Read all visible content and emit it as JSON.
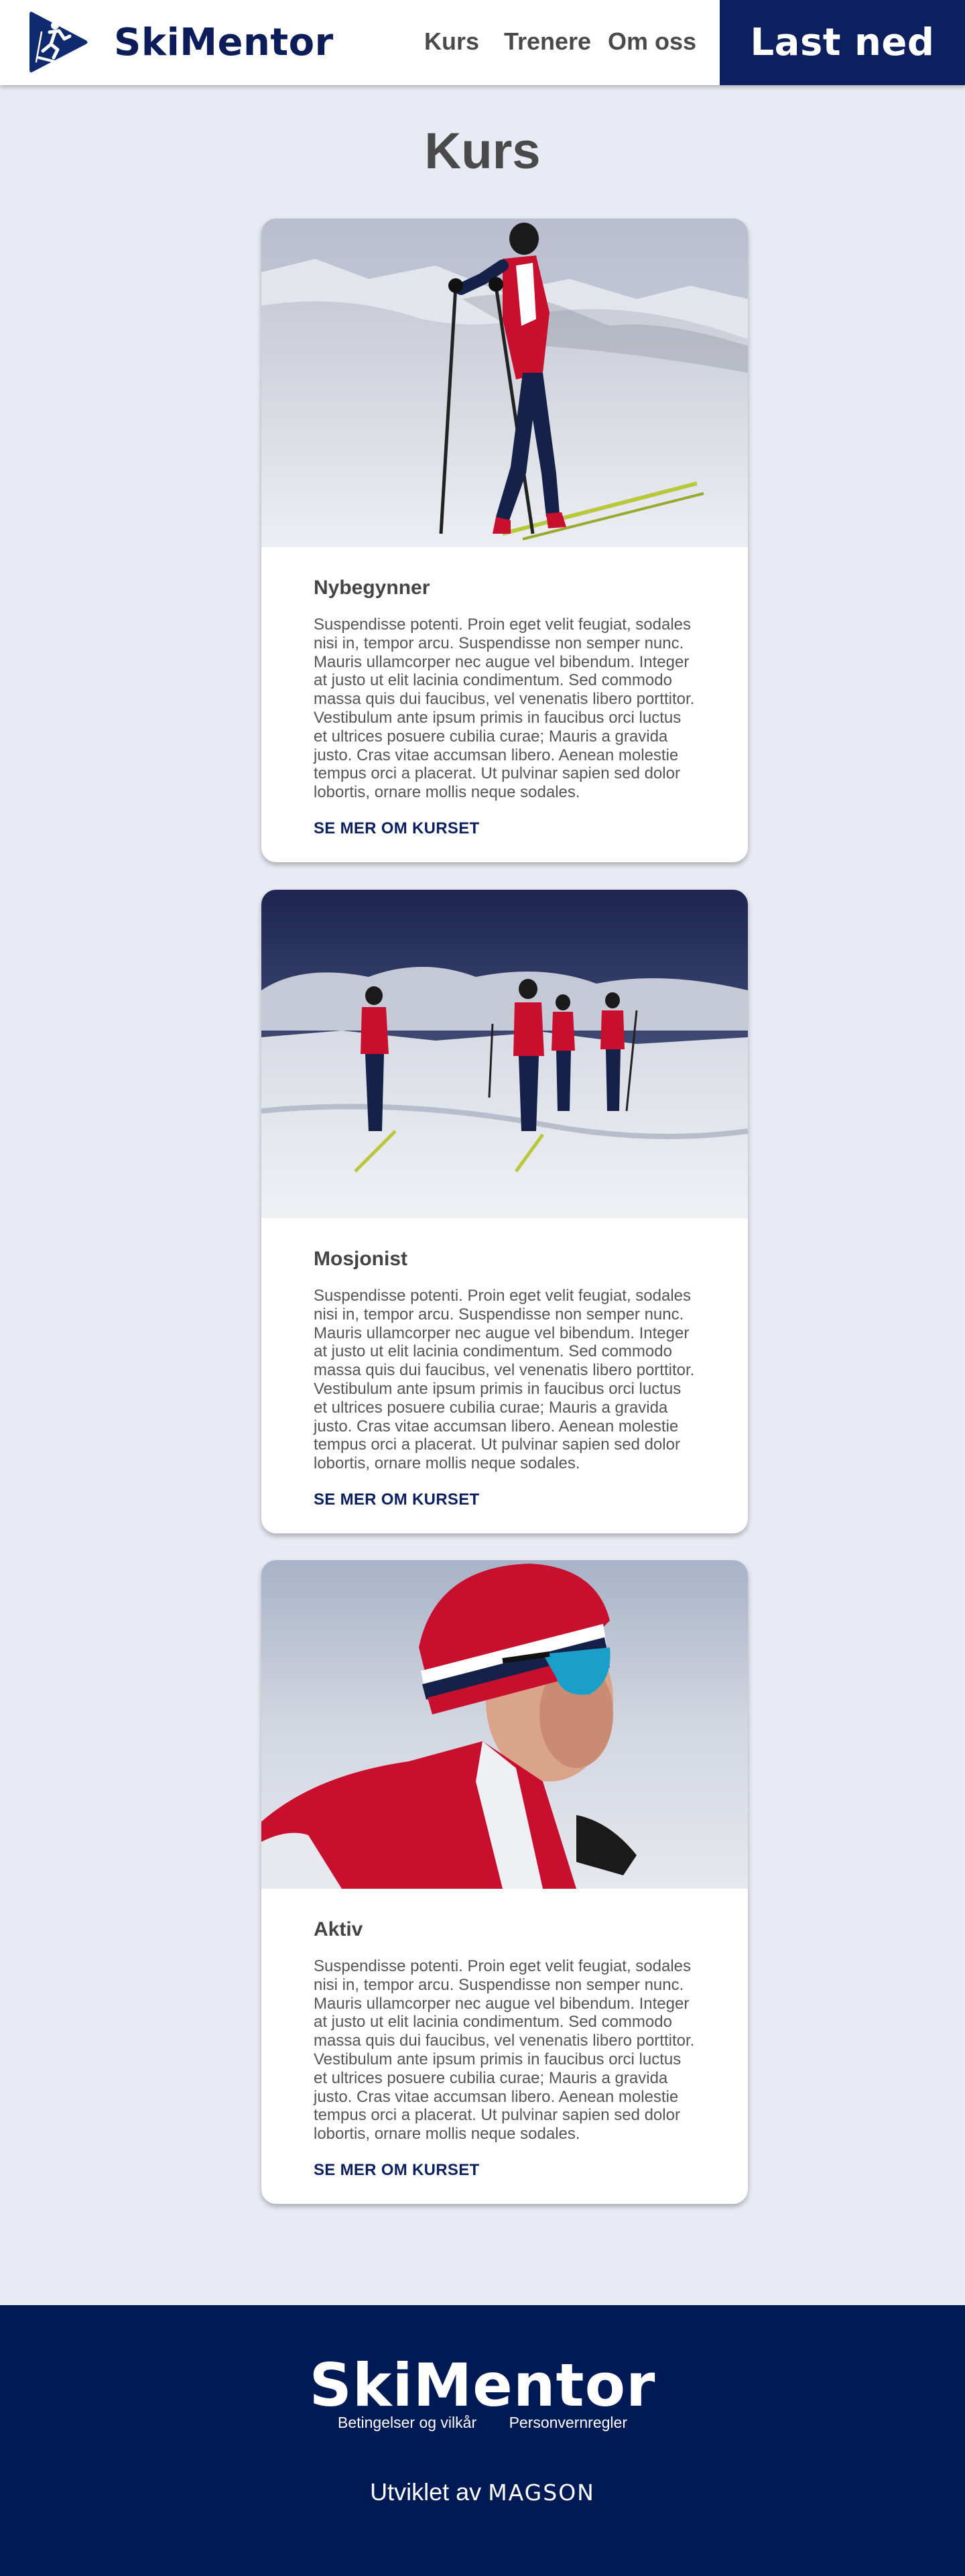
{
  "header": {
    "brand": "SkiMentor",
    "logo_icon": "skier-play-icon",
    "nav": [
      {
        "label": "Kurs"
      },
      {
        "label": "Trenere"
      },
      {
        "label": "Om oss"
      }
    ],
    "download_label": "Last ned"
  },
  "main": {
    "title": "Kurs",
    "courses": [
      {
        "title": "Nybegynner",
        "image": "skier-poles-snow-photo",
        "description": "Suspendisse potenti. Proin eget velit feugiat, sodales nisi in, tempor arcu. Suspendisse non semper nunc. Mauris ullamcorper nec augue vel bibendum. Integer at justo ut elit lacinia condimentum. Sed commodo massa quis dui faucibus, vel venenatis libero porttitor. Vestibulum ante ipsum primis in faucibus orci luctus et ultrices posuere cubilia curae; Mauris a gravida justo. Cras vitae accumsan libero. Aenean molestie tempus orci a placerat. Ut pulvinar sapien sed dolor lobortis, ornare mollis neque sodales.",
        "link": "SE MER OM KURSET"
      },
      {
        "title": "Mosjonist",
        "image": "group-skiers-photo",
        "description": "Suspendisse potenti. Proin eget velit feugiat, sodales nisi in, tempor arcu. Suspendisse non semper nunc. Mauris ullamcorper nec augue vel bibendum. Integer at justo ut elit lacinia condimentum. Sed commodo massa quis dui faucibus, vel venenatis libero porttitor. Vestibulum ante ipsum primis in faucibus orci luctus et ultrices posuere cubilia curae; Mauris a gravida justo. Cras vitae accumsan libero. Aenean molestie tempus orci a placerat. Ut pulvinar sapien sed dolor lobortis, ornare mollis neque sodales.",
        "link": "SE MER OM KURSET"
      },
      {
        "title": "Aktiv",
        "image": "skier-portrait-photo",
        "description": "Suspendisse potenti. Proin eget velit feugiat, sodales nisi in, tempor arcu. Suspendisse non semper nunc. Mauris ullamcorper nec augue vel bibendum. Integer at justo ut elit lacinia condimentum. Sed commodo massa quis dui faucibus, vel venenatis libero porttitor. Vestibulum ante ipsum primis in faucibus orci luctus et ultrices posuere cubilia curae; Mauris a gravida justo. Cras vitae accumsan libero. Aenean molestie tempus orci a placerat. Ut pulvinar sapien sed dolor lobortis, ornare mollis neque sodales.",
        "link": "SE MER OM KURSET"
      }
    ]
  },
  "footer": {
    "brand": "SkiMentor",
    "links": [
      {
        "label": "Betingelser og vilkår"
      },
      {
        "label": "Personvernregler"
      }
    ],
    "credit_prefix": "Utviklet av",
    "credit_company": "MAGSON"
  },
  "colors": {
    "primary": "#0c1f5e",
    "footer_bg": "#001a55",
    "page_bg": "#e8ebf4",
    "card_bg": "#ffffff",
    "text": "#444444"
  }
}
